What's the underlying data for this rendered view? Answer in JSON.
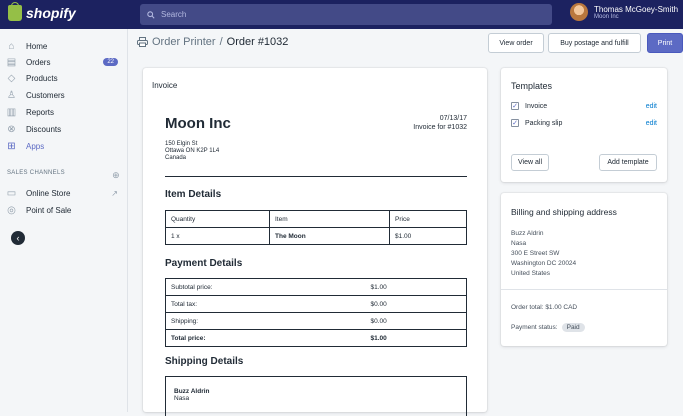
{
  "app": {
    "brand": "shopify",
    "search_placeholder": "Search",
    "user_name": "Thomas McGoey-Smith",
    "user_store": "Moon Inc"
  },
  "sidebar": {
    "items": [
      {
        "label": "Home",
        "icon": "home-icon"
      },
      {
        "label": "Orders",
        "icon": "orders-icon",
        "badge": "22"
      },
      {
        "label": "Products",
        "icon": "tag-icon"
      },
      {
        "label": "Customers",
        "icon": "person-icon"
      },
      {
        "label": "Reports",
        "icon": "bar-chart-icon"
      },
      {
        "label": "Discounts",
        "icon": "discount-icon"
      },
      {
        "label": "Apps",
        "icon": "apps-icon"
      }
    ],
    "section_title": "SALES CHANNELS",
    "channels": [
      {
        "label": "Online Store",
        "icon": "store-icon"
      },
      {
        "label": "Point of Sale",
        "icon": "location-icon"
      }
    ]
  },
  "header": {
    "crumb_parent": "Order Printer",
    "crumb_sep": "/",
    "crumb_current": "Order #1032",
    "btn_view": "View order",
    "btn_postage": "Buy postage and fulfill",
    "btn_print": "Print"
  },
  "invoice": {
    "card_title": "Invoice",
    "company": "Moon Inc",
    "date": "07/13/17",
    "invoice_for": "Invoice for #1032",
    "address": [
      "150 Elgin St",
      "Ottawa ON K2P 1L4",
      "Canada"
    ],
    "item_heading": "Item Details",
    "item_headers": [
      "Quantity",
      "Item",
      "Price"
    ],
    "items": [
      [
        "1 x",
        "The Moon",
        "$1.00"
      ]
    ],
    "payment_heading": "Payment Details",
    "payment": [
      [
        "Subtotal price:",
        "$1.00"
      ],
      [
        "Total tax:",
        "$0.00"
      ],
      [
        "Shipping:",
        "$0.00"
      ],
      [
        "Total price:",
        "$1.00"
      ]
    ],
    "shipping_heading": "Shipping Details",
    "ship_name": "Buzz Aldrin",
    "ship_line": "Nasa"
  },
  "templates": {
    "title": "Templates",
    "rows": [
      {
        "label": "Invoice",
        "action": "edit"
      },
      {
        "label": "Packing slip",
        "action": "edit"
      }
    ],
    "view_all": "View all",
    "add": "Add template"
  },
  "billing": {
    "title": "Billing and shipping address",
    "lines": [
      "Buzz Aldrin",
      "Nasa",
      "300 E Street SW",
      "Washington DC 20024",
      "United States"
    ],
    "order_total": "Order total: $1.00 CAD",
    "payment_status_label": "Payment status:",
    "payment_status": "Paid"
  }
}
